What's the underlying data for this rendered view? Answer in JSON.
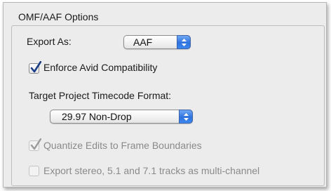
{
  "group": {
    "title": "OMF/AAF Options"
  },
  "export_as": {
    "label": "Export As:",
    "selected": "AAF"
  },
  "enforce_avid": {
    "label": "Enforce Avid Compatibility",
    "checked": true
  },
  "timecode": {
    "label": "Target Project Timecode Format:",
    "selected": "29.97 Non-Drop"
  },
  "quantize": {
    "label": "Quantize Edits to Frame Boundaries",
    "checked": true,
    "enabled": false
  },
  "multichannel": {
    "label": "Export stereo, 5.1 and 7.1 tracks as multi-channel",
    "checked": false,
    "enabled": false
  },
  "colors": {
    "accent": "#2f73de",
    "disabled_text": "#8a8a8a"
  }
}
